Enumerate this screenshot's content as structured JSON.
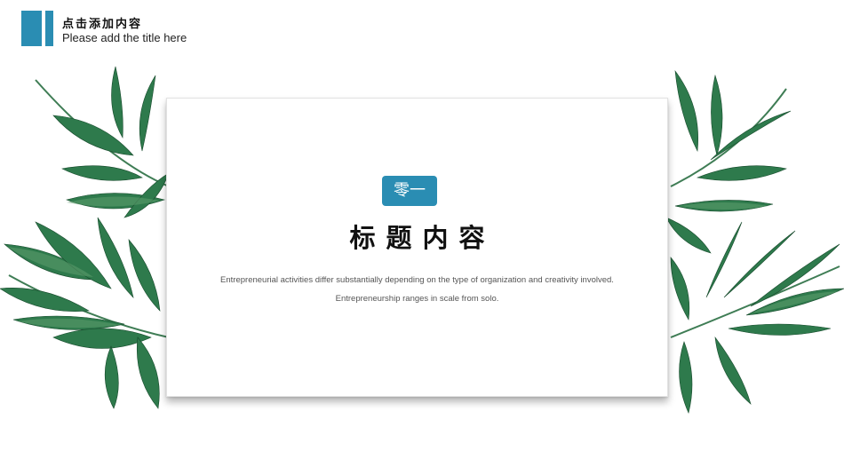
{
  "header": {
    "title": "点击添加内容",
    "subtitle": "Please add the title here"
  },
  "card": {
    "badge": "零一",
    "title": "标题内容",
    "body": "Entrepreneurial activities differ substantially depending on the type of organization and creativity involved. Entrepreneurship ranges in scale from solo."
  },
  "colors": {
    "accent": "#2a8db3",
    "leaf_dark": "#1f5e3a",
    "leaf_mid": "#2e7a4c",
    "leaf_light": "#5e9e6e"
  },
  "decorations": [
    "left-leaf-branch-image",
    "right-leaf-branch-image"
  ]
}
